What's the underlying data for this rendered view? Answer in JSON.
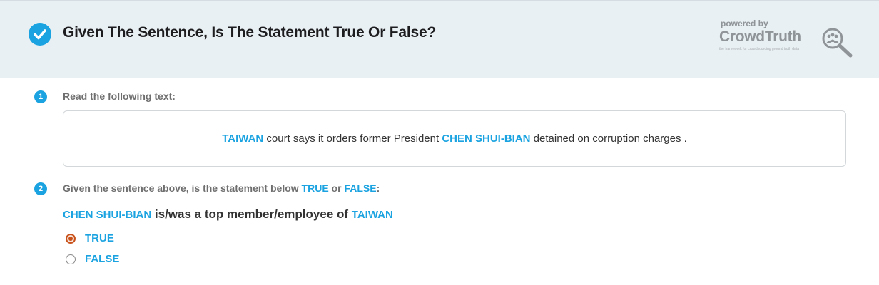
{
  "header": {
    "title": "Given The Sentence, Is The Statement True Or False?",
    "check_icon": "check-circle-icon"
  },
  "branding": {
    "powered_by": "powered by",
    "logo_text": "CrowdTruth",
    "tagline": "the framework for crowdsourcing ground truth data"
  },
  "step1": {
    "number": "1",
    "label": "Read the following text:"
  },
  "sentence": {
    "entity1": "TAIWAN",
    "part1": " court says it orders former President ",
    "entity2": "CHEN SHUI-BIAN",
    "part2": " detained on corruption charges ."
  },
  "step2": {
    "number": "2",
    "prefix": "Given the sentence above, is the statement below ",
    "true_word": "TRUE",
    "or_word": " or ",
    "false_word": "FALSE",
    "suffix": ":"
  },
  "statement": {
    "subject": "CHEN SHUI-BIAN",
    "relation": " is/was a top member/employee of ",
    "object": "TAIWAN"
  },
  "options": [
    {
      "label": "TRUE",
      "selected": true
    },
    {
      "label": "FALSE",
      "selected": false
    }
  ],
  "colors": {
    "accent": "#1aa3e0",
    "header_bg": "#e9f0f4",
    "selected_radio": "#c9521a"
  }
}
